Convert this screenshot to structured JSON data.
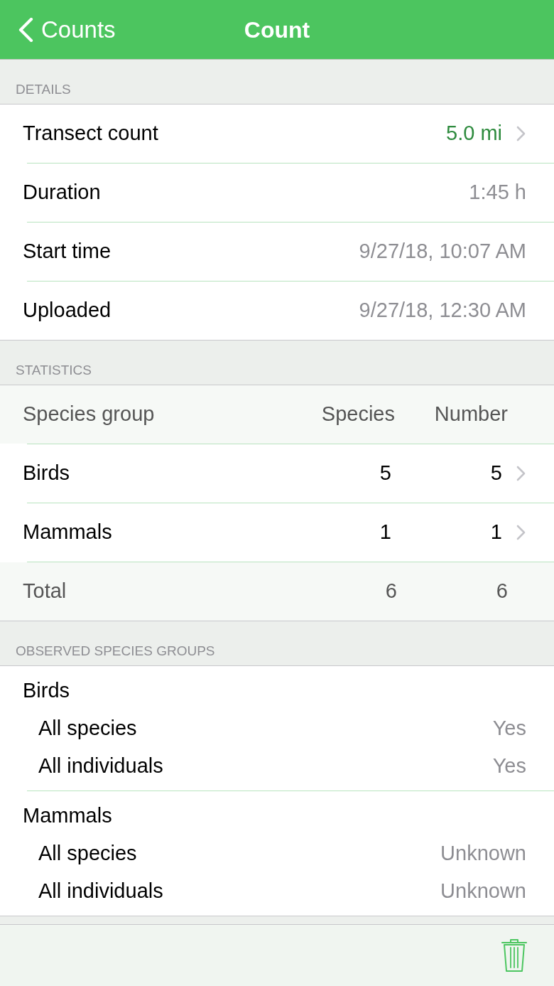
{
  "nav_bar": {
    "back": "Counts",
    "title": "Count"
  },
  "details": {
    "header": "DETAILS",
    "rows": [
      {
        "label": "Transect count",
        "value": "5.0 mi",
        "disclosure": true
      },
      {
        "label": "Duration",
        "value": "1:45 h",
        "disclosure": false
      },
      {
        "label": "Start time",
        "value": "9/27/18, 10:07 AM",
        "disclosure": false
      },
      {
        "label": "Uploaded",
        "value": "9/27/18, 12:30 AM",
        "disclosure": false
      }
    ]
  },
  "statistics": {
    "header": "STATISTICS",
    "columns": [
      "Species group",
      "Species",
      "Number"
    ],
    "rows": [
      {
        "kind": "group",
        "cells": [
          "Birds",
          "5",
          "5"
        ],
        "disclosure": true
      },
      {
        "kind": "group",
        "cells": [
          "Mammals",
          "1",
          "1"
        ],
        "disclosure": true
      },
      {
        "kind": "total",
        "cells": [
          "Total",
          "6",
          "6"
        ],
        "disclosure": false
      }
    ]
  },
  "observed_species_groups": {
    "header": "OBSERVED SPECIES GROUPS",
    "groups": [
      {
        "name": "Birds",
        "items": [
          {
            "label": "All species",
            "value": "Yes"
          },
          {
            "label": "All individuals",
            "value": "Yes"
          }
        ]
      },
      {
        "name": "Mammals",
        "items": [
          {
            "label": "All species",
            "value": "Unknown"
          },
          {
            "label": "All individuals",
            "value": "Unknown"
          }
        ]
      }
    ]
  }
}
